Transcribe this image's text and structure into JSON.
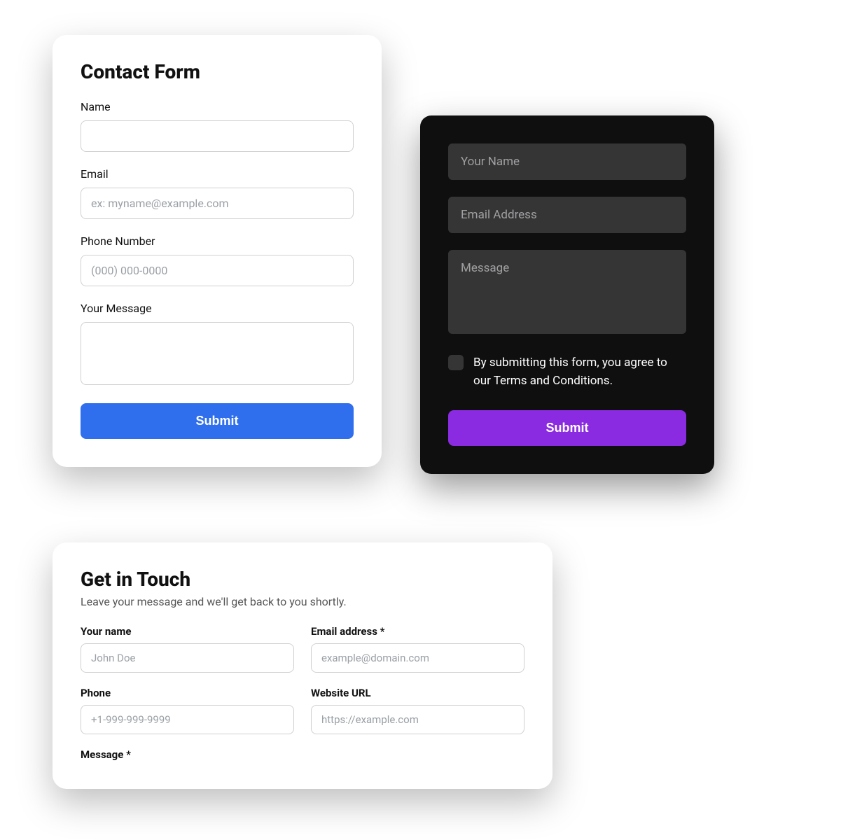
{
  "card1": {
    "title": "Contact Form",
    "name_label": "Name",
    "email_label": "Email",
    "email_placeholder": "ex: myname@example.com",
    "phone_label": "Phone Number",
    "phone_placeholder": "(000) 000-0000",
    "message_label": "Your Message",
    "submit_label": "Submit"
  },
  "card2": {
    "name_placeholder": "Your Name",
    "email_placeholder": "Email Address",
    "message_placeholder": "Message",
    "terms_text": "By submitting this form, you agree to our Terms and Conditions.",
    "submit_label": "Submit"
  },
  "card3": {
    "title": "Get in Touch",
    "subtitle": "Leave your message and we'll get back to you shortly.",
    "name_label": "Your name",
    "name_placeholder": "John Doe",
    "email_label": "Email address *",
    "email_placeholder": "example@domain.com",
    "phone_label": "Phone",
    "phone_placeholder": "+1-999-999-9999",
    "website_label": "Website URL",
    "website_placeholder": "https://example.com",
    "message_label": "Message *"
  }
}
